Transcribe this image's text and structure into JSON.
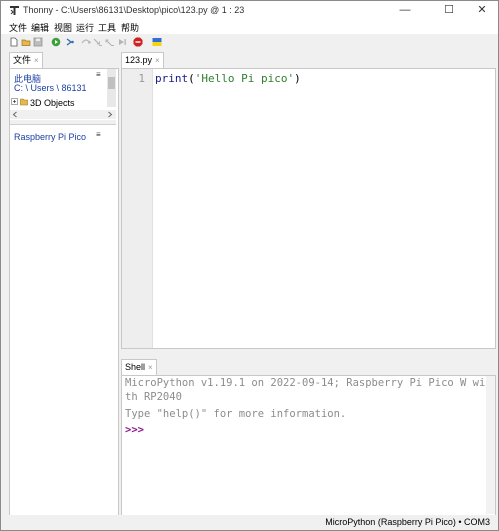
{
  "window": {
    "title": "Thonny  -  C:\\Users\\86131\\Desktop\\pico\\123.py  @  1 : 23",
    "minimize_glyph": "—",
    "maximize_glyph": "☐",
    "close_glyph": "✕"
  },
  "menu": [
    "文件",
    "编辑",
    "视图",
    "运行",
    "工具",
    "帮助"
  ],
  "toolbar": {
    "icons": [
      "new-file-icon",
      "open-file-icon",
      "save-icon",
      "run-icon",
      "debug-icon",
      "step-over-icon",
      "step-into-icon",
      "step-out-icon",
      "resume-icon",
      "stop-icon",
      "support-ukraine-icon"
    ]
  },
  "files_panel": {
    "tab_label": "文件",
    "tab_close": "×",
    "this_pc_label": "此电脑",
    "path_label": "C: \\ Users \\ 86131",
    "tree_item": "3D Objects",
    "menu_glyph": "≡",
    "device_label": "Raspberry Pi Pico"
  },
  "editor": {
    "tab_label": "123.py",
    "tab_close": "×",
    "line_number": "1",
    "code": {
      "func": "print",
      "open_paren": "(",
      "string": "'Hello Pi pico'",
      "close_paren": ")"
    }
  },
  "shell": {
    "tab_label": "Shell",
    "tab_close": "×",
    "banner_line1": "MicroPython v1.19.1 on 2022-09-14; Raspberry Pi Pico W wi",
    "banner_line2": "th RP2040",
    "help_line": "Type \"help()\" for more information.",
    "prompt": ">>>"
  },
  "status": {
    "interpreter": "MicroPython (Raspberry Pi Pico)  •  COM3"
  },
  "colors": {
    "accent_blue": "#1a3fa3",
    "code_func": "#1a1a8c",
    "code_string": "#2f7f2f",
    "prompt": "#8b1a8b"
  }
}
